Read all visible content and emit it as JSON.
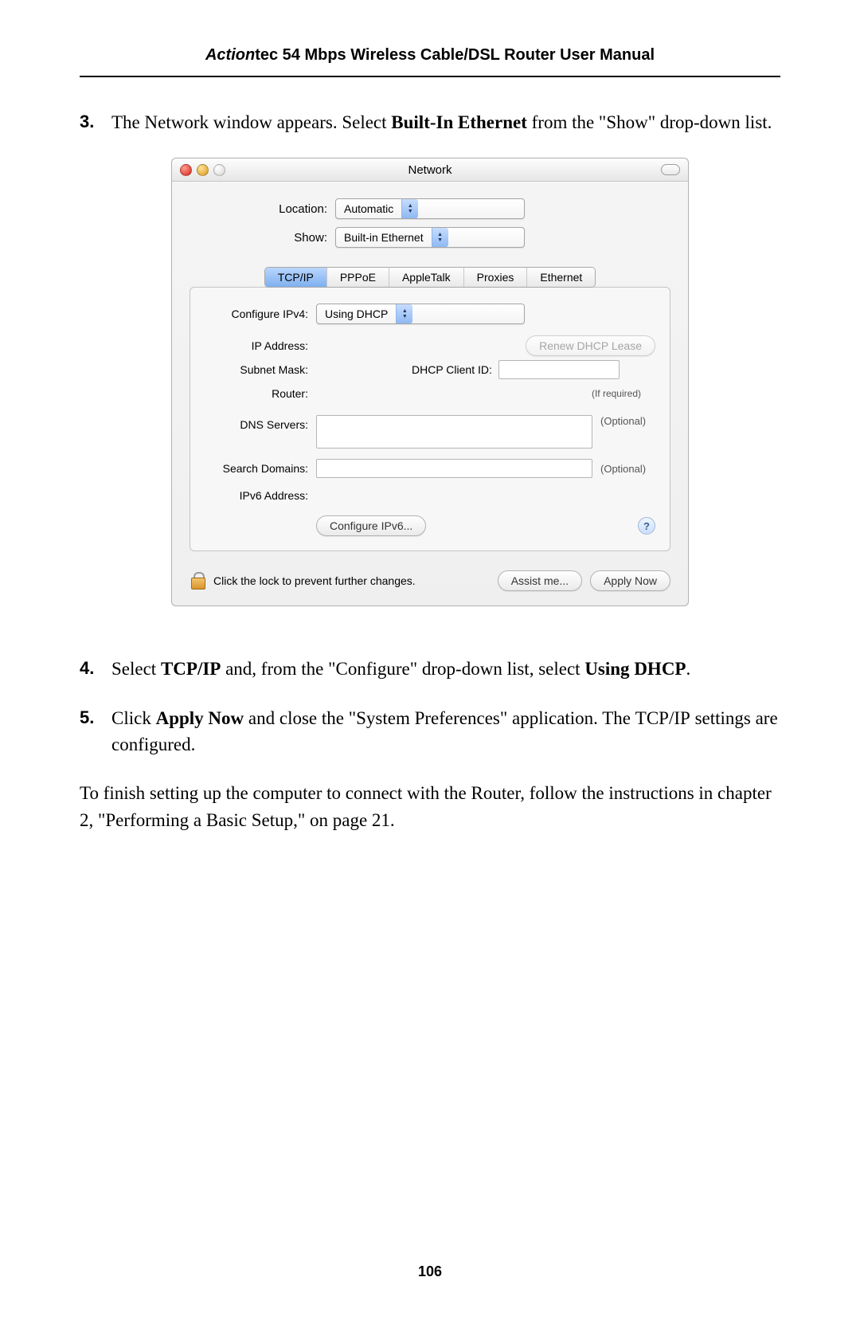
{
  "header": {
    "brand_italic": "Action",
    "brand_rest": "tec 54 Mbps Wireless Cable/DSL Router User Manual"
  },
  "steps": {
    "s3": {
      "num": "3.",
      "pre": "The Network window appears. Select ",
      "bold": "Built-In Ethernet",
      "post": " from the \"Show\" drop-down list."
    },
    "s4": {
      "num": "4.",
      "t1": "Select ",
      "b1": "TCP/IP",
      "t2": " and, from the \"Configure\" drop-down list, select ",
      "b2": "Using ",
      "sc2": "DHCP",
      "t3": "."
    },
    "s5": {
      "num": "5.",
      "t1": "Click ",
      "b1": "Apply Now",
      "t2": " and close the \"System Preferences\" application. The ",
      "sc1": "TCP/IP",
      "t3": " settings are configured."
    }
  },
  "closing": "To finish setting up the computer to connect with the Router, follow the instructions in chapter 2, \"Performing a Basic Setup,\" on page 21.",
  "page_number": "106",
  "macwin": {
    "title": "Network",
    "location_label": "Location:",
    "location_value": "Automatic",
    "show_label": "Show:",
    "show_value": "Built-in Ethernet",
    "tabs": [
      "TCP/IP",
      "PPPoE",
      "AppleTalk",
      "Proxies",
      "Ethernet"
    ],
    "configure_ipv4_label": "Configure IPv4:",
    "configure_ipv4_value": "Using DHCP",
    "ip_label": "IP Address:",
    "renew_btn": "Renew DHCP Lease",
    "subnet_label": "Subnet Mask:",
    "dhcp_client_label": "DHCP Client ID:",
    "if_required": "(If required)",
    "router_label": "Router:",
    "dns_label": "DNS Servers:",
    "optional": "(Optional)",
    "search_label": "Search Domains:",
    "ipv6addr_label": "IPv6 Address:",
    "configure_ipv6_btn": "Configure IPv6...",
    "help": "?",
    "lock_text": "Click the lock to prevent further changes.",
    "assist_btn": "Assist me...",
    "apply_btn": "Apply Now"
  }
}
